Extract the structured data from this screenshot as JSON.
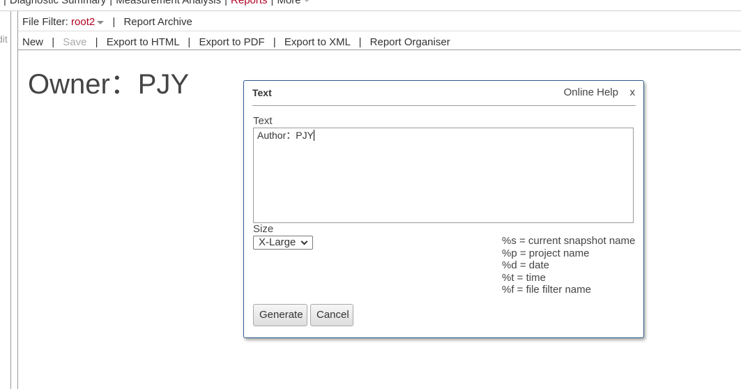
{
  "topnav": {
    "items": [
      "Diagnostic Summary",
      "Measurement Analysis",
      "Reports",
      "More"
    ],
    "active": "Reports"
  },
  "sidebar": {
    "stub_label": "dit"
  },
  "toolbar1": {
    "file_filter_label": "File Filter:",
    "file_filter_value": "root2",
    "report_archive": "Report Archive"
  },
  "toolbar2": {
    "new": "New",
    "save": "Save",
    "export_html": "Export to HTML",
    "export_pdf": "Export to PDF",
    "export_xml": "Export to XML",
    "report_organiser": "Report Organiser"
  },
  "report": {
    "heading": "Owner：PJY"
  },
  "dialog": {
    "title": "Text",
    "online_help": "Online Help",
    "close": "x",
    "text_label": "Text",
    "text_value": "Author：PJY",
    "size_label": "Size",
    "size_value": "X-Large",
    "hints": [
      "%s = current snapshot name",
      "%p = project name",
      "%d = date",
      "%t = time",
      "%f = file filter name"
    ],
    "generate": "Generate",
    "cancel": "Cancel"
  },
  "colors": {
    "accent_red": "#b00020",
    "dialog_border": "#2d5a8c"
  }
}
